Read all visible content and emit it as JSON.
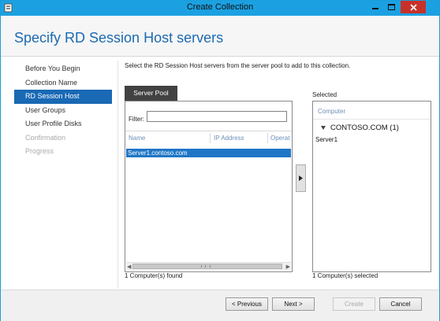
{
  "window": {
    "title": "Create Collection",
    "controls": {
      "minimize": "minimize-icon",
      "maximize": "maximize-icon",
      "close": "close-icon"
    }
  },
  "header": {
    "page_title": "Specify RD Session Host servers"
  },
  "sidebar": {
    "items": [
      {
        "label": "Before You Begin",
        "state": "normal"
      },
      {
        "label": "Collection Name",
        "state": "normal"
      },
      {
        "label": "RD Session Host",
        "state": "selected"
      },
      {
        "label": "User Groups",
        "state": "normal"
      },
      {
        "label": "User Profile Disks",
        "state": "normal"
      },
      {
        "label": "Confirmation",
        "state": "disabled"
      },
      {
        "label": "Progress",
        "state": "disabled"
      }
    ]
  },
  "main": {
    "instruction": "Select the RD Session Host servers from the server pool to add to this collection.",
    "server_pool": {
      "tab_label": "Server Pool",
      "filter_label": "Filter:",
      "filter_value": "",
      "columns": [
        "Name",
        "IP Address",
        "Operat"
      ],
      "rows": [
        {
          "name": "Server1.contoso.com",
          "selected": true
        }
      ],
      "status": "1 Computer(s) found"
    },
    "move_button_icon": "right-arrow-icon",
    "selected": {
      "label": "Selected",
      "column": "Computer",
      "group": "CONTOSO.COM (1)",
      "items": [
        "Server1"
      ],
      "status": "1 Computer(s) selected"
    }
  },
  "footer": {
    "previous": "< Previous",
    "next": "Next >",
    "create": "Create",
    "cancel": "Cancel"
  },
  "colors": {
    "titlebar": "#1ba1e2",
    "close": "#c7312a",
    "selection": "#1969b5",
    "heading": "#1c6ab0"
  }
}
